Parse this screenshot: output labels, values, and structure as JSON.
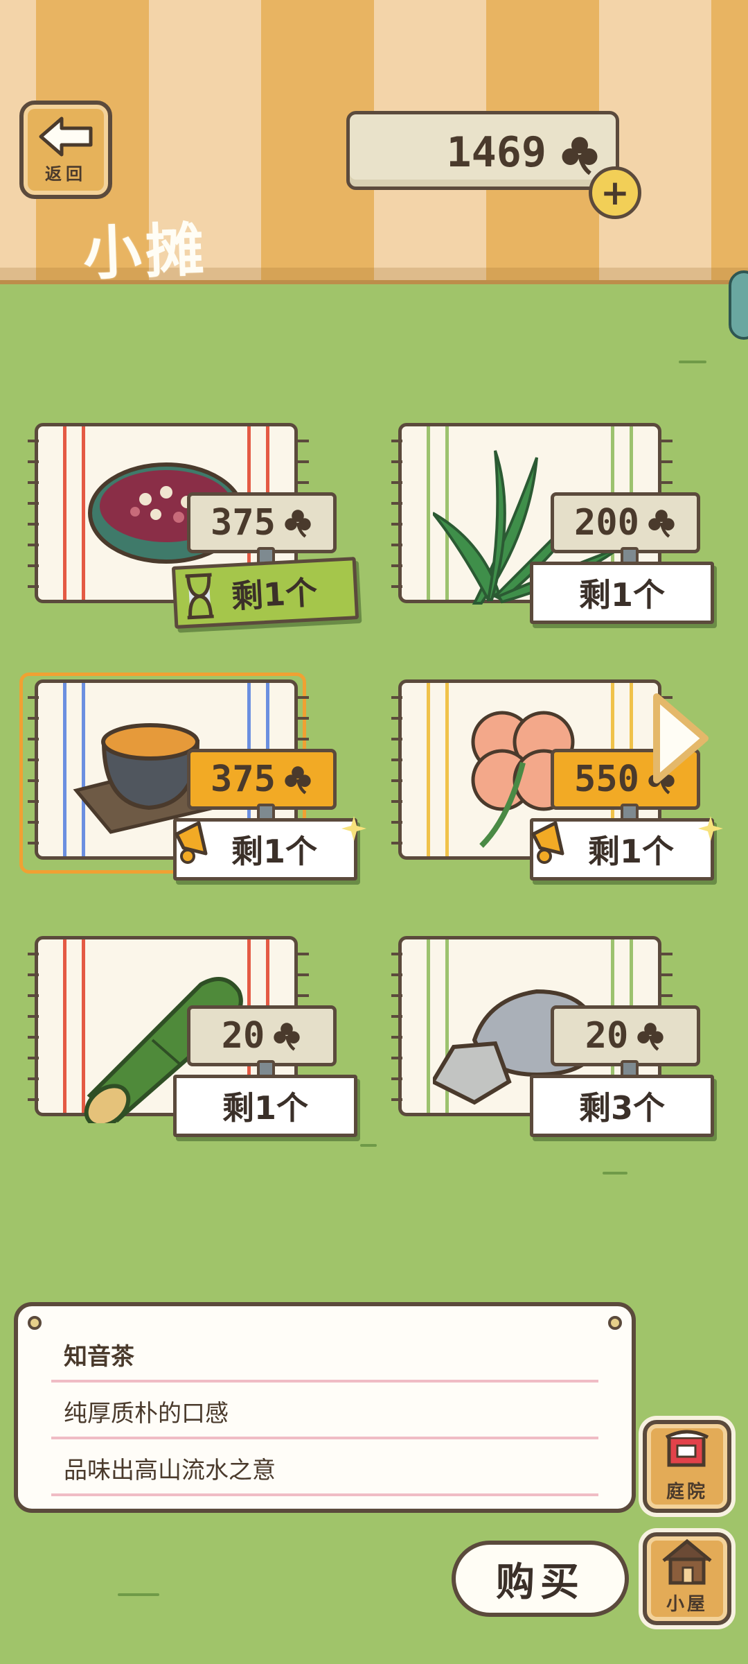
{
  "header": {
    "back_label": "返回",
    "title": "小摊",
    "currency_value": "1469",
    "currency_icon": "clover-icon",
    "plus_icon": "plus-icon"
  },
  "items": [
    {
      "price": "375",
      "stock": "剩1个",
      "art": "bean-soup-bowl",
      "stripe": "red"
    },
    {
      "price": "200",
      "stock": "剩1个",
      "art": "green-leaf",
      "stripe": "green"
    },
    {
      "price": "375",
      "stock": "剩1个",
      "art": "tea-bowl",
      "stripe": "blue"
    },
    {
      "price": "550",
      "stock": "剩1个",
      "art": "four-leaf-clover",
      "stripe": "yellow"
    },
    {
      "price": "20",
      "stock": "剩1个",
      "art": "bamboo-tube",
      "stripe": "red"
    },
    {
      "price": "20",
      "stock": "剩3个",
      "art": "rocks",
      "stripe": "green"
    }
  ],
  "description": {
    "name": "知音茶",
    "line1": "纯厚质朴的口感",
    "line2": "品味出高山流水之意"
  },
  "buttons": {
    "yard": "庭院",
    "house": "小屋",
    "buy": "购买"
  },
  "colors": {
    "grass": "#a0c46a",
    "price_highlight": "#f2aa25",
    "limited_tag": "#a5c64b",
    "selection": "#f0a133"
  }
}
